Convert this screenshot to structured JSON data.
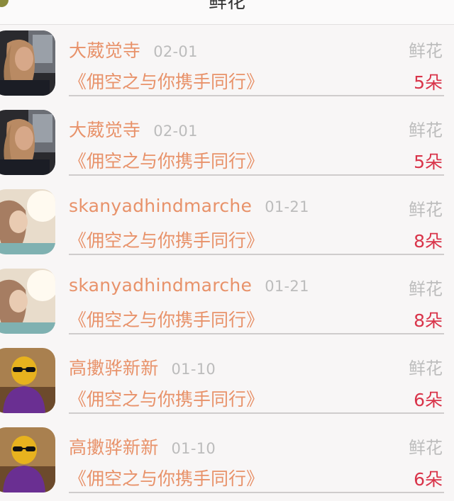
{
  "nav": {
    "title": "鲜花"
  },
  "records": [
    {
      "name": "大葳觉寺",
      "date": "02-01",
      "type": "鲜花",
      "work": "《佣空之与你携手同行》",
      "qty": "5朵",
      "avatar": "woman-car"
    },
    {
      "name": "大葳觉寺",
      "date": "02-01",
      "type": "鲜花",
      "work": "《佣空之与你携手同行》",
      "qty": "5朵",
      "avatar": "woman-car"
    },
    {
      "name": "skanyadhindmarche",
      "date": "01-21",
      "type": "鲜花",
      "work": "《佣空之与你携手同行》",
      "qty": "8朵",
      "avatar": "sunlit-girl"
    },
    {
      "name": "skanyadhindmarche",
      "date": "01-21",
      "type": "鲜花",
      "work": "《佣空之与你携手同行》",
      "qty": "8朵",
      "avatar": "sunlit-girl"
    },
    {
      "name": "高擻骅新新",
      "date": "01-10",
      "type": "鲜花",
      "work": "《佣空之与你携手同行》",
      "qty": "6朵",
      "avatar": "sunglasses-man"
    },
    {
      "name": "高擻骅新新",
      "date": "01-10",
      "type": "鲜花",
      "work": "《佣空之与你携手同行》",
      "qty": "6朵",
      "avatar": "sunglasses-man"
    }
  ]
}
